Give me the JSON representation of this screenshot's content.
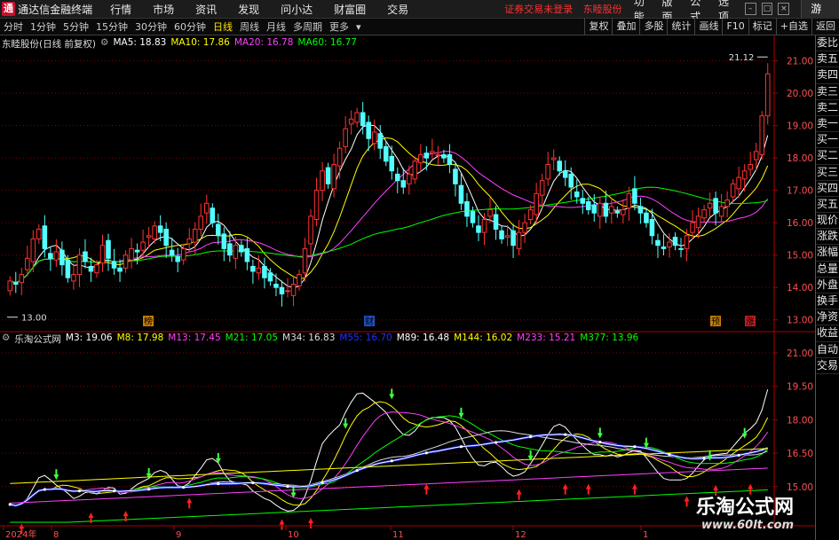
{
  "app": {
    "logo_glyph": "通",
    "title": "通达信金融终端"
  },
  "menu": [
    "行情",
    "市场",
    "资讯",
    "发现",
    "问小达",
    "财富圈",
    "交易"
  ],
  "notice": {
    "login": "证券交易未登录",
    "stock": "东睦股份"
  },
  "menu_right": [
    "功能",
    "版面",
    "公式",
    "选项"
  ],
  "guest_label": "游客",
  "periods": [
    "分时",
    "1分钟",
    "5分钟",
    "15分钟",
    "30分钟",
    "60分钟",
    "日线",
    "周线",
    "月线",
    "多周期",
    "更多"
  ],
  "active_period": "日线",
  "toolbar_right": [
    "复权",
    "叠加",
    "多股",
    "统计",
    "画线",
    "F10",
    "标记",
    "+自选",
    "返回"
  ],
  "sidebar": [
    "委比",
    "卖五",
    "卖四",
    "卖三",
    "卖二",
    "卖一",
    "买一",
    "买二",
    "买三",
    "买四",
    "买五",
    "现价",
    "涨跌",
    "涨幅",
    "总量",
    "外盘",
    "换手",
    "净资",
    "收益",
    "自动",
    "交易"
  ],
  "main_pane": {
    "stock_label": "东睦股份(日线 前复权)",
    "mas": [
      {
        "label": "MA5: 18.83",
        "color": "#ffffff"
      },
      {
        "label": "MA10: 17.86",
        "color": "#ffff00"
      },
      {
        "label": "MA20: 16.78",
        "color": "#ff40ff"
      },
      {
        "label": "MA60: 16.77",
        "color": "#00ff00"
      }
    ],
    "high_label": "21.12",
    "low_label": "13.00",
    "markers": {
      "bang": "榜",
      "cai": "财",
      "yu": "预",
      "zhang": "涨"
    }
  },
  "sub_pane": {
    "title": "乐淘公式网",
    "mas": [
      {
        "label": "M3: 19.06",
        "color": "#ffffff"
      },
      {
        "label": "M8: 17.98",
        "color": "#ffff00"
      },
      {
        "label": "M13: 17.45",
        "color": "#ff40ff"
      },
      {
        "label": "M21: 17.05",
        "color": "#00ff00"
      },
      {
        "label": "M34: 16.83",
        "color": "#dddddd"
      },
      {
        "label": "M55: 16.70",
        "color": "#2030ff"
      },
      {
        "label": "M89: 16.48",
        "color": "#ffffff"
      },
      {
        "label": "M144: 16.02",
        "color": "#ffff00"
      },
      {
        "label": "M233: 15.21",
        "color": "#ff40ff"
      },
      {
        "label": "M377: 13.96",
        "color": "#00ff00"
      }
    ]
  },
  "date_axis": [
    {
      "label": "2024年",
      "date": "2024-07"
    },
    {
      "label": "8",
      "date": "2024-08"
    },
    {
      "label": "9",
      "date": "2024-09"
    },
    {
      "label": "10",
      "date": "2024-10"
    },
    {
      "label": "11",
      "date": "2024-11"
    },
    {
      "label": "12",
      "date": "2024-12"
    },
    {
      "label": "1",
      "date": "2025-01"
    }
  ],
  "chart_data": [
    {
      "type": "candlestick",
      "title": "东睦股份(日线 前复权)",
      "ylim": [
        12.8,
        21.4
      ],
      "y_ticks": [
        "21.00",
        "20.00",
        "19.00",
        "18.00",
        "17.00",
        "16.00",
        "15.00",
        "14.00",
        "13.00"
      ],
      "y_tick_values": [
        21,
        20,
        19,
        18,
        17,
        16,
        15,
        14,
        13
      ],
      "close": [
        14.2,
        14.1,
        14.4,
        14.9,
        15.5,
        15.8,
        15.2,
        14.9,
        15.1,
        14.7,
        14.3,
        14.4,
        15.0,
        14.8,
        14.5,
        14.7,
        15.3,
        14.9,
        14.6,
        14.5,
        15.0,
        15.2,
        15.1,
        15.4,
        15.6,
        15.9,
        15.7,
        15.3,
        15.0,
        14.8,
        15.2,
        15.5,
        15.8,
        16.2,
        16.6,
        16.0,
        15.6,
        15.2,
        15.0,
        15.3,
        15.1,
        14.8,
        14.5,
        14.6,
        14.3,
        14.2,
        14.0,
        13.8,
        13.9,
        14.1,
        14.4,
        15.2,
        16.2,
        17.0,
        17.6,
        17.2,
        17.8,
        18.3,
        18.9,
        19.2,
        19.4,
        19.0,
        18.6,
        18.8,
        18.3,
        17.9,
        17.6,
        17.3,
        17.1,
        17.5,
        17.9,
        18.1,
        18.0,
        18.2,
        18.1,
        18.0,
        17.8,
        17.2,
        16.6,
        16.2,
        16.0,
        15.7,
        16.1,
        16.4,
        15.8,
        15.5,
        15.6,
        15.3,
        15.7,
        16.0,
        16.4,
        16.9,
        17.3,
        17.8,
        18.0,
        17.6,
        17.4,
        17.1,
        16.8,
        16.6,
        16.4,
        16.3,
        16.6,
        16.2,
        16.5,
        16.3,
        16.4,
        16.9,
        16.6,
        16.3,
        16.0,
        15.6,
        15.3,
        15.2,
        15.4,
        15.3,
        15.2,
        15.6,
        16.0,
        16.2,
        16.4,
        16.6,
        16.3,
        16.5,
        16.7,
        17.2,
        17.4,
        17.6,
        17.8,
        18.2,
        19.3,
        20.6
      ],
      "high_point": 21.12,
      "low_point": 13.0,
      "ma_latest": {
        "MA5": 18.83,
        "MA10": 17.86,
        "MA20": 16.78,
        "MA60": 16.77
      }
    },
    {
      "type": "line",
      "title": "乐淘公式网",
      "ylim": [
        13.4,
        21.4
      ],
      "y_ticks": [
        "21.00",
        "19.50",
        "18.00",
        "16.50",
        "15.00"
      ],
      "y_tick_values": [
        21.0,
        19.5,
        18.0,
        16.5,
        15.0
      ],
      "series_latest": {
        "M3": 19.06,
        "M8": 17.98,
        "M13": 17.45,
        "M21": 17.05,
        "M34": 16.83,
        "M55": 16.7,
        "M89": 16.48,
        "M144": 16.02,
        "M233": 15.21,
        "M377": 13.96
      }
    }
  ],
  "watermark": {
    "main": "乐淘公式网",
    "sub": "www.60lt.com"
  },
  "colors": {
    "up": "#ff3232",
    "down": "#54ffff",
    "grid": "#8a0000",
    "axis": "#b00000"
  }
}
